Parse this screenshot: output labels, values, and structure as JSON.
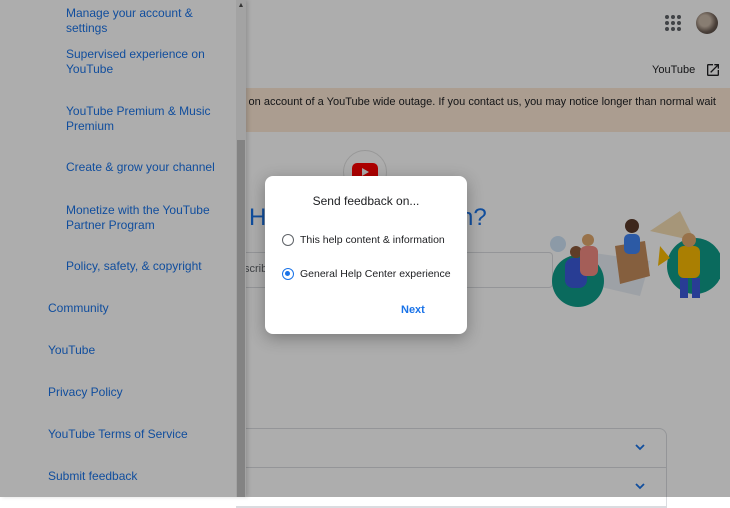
{
  "header": {
    "youtube_link_label": "YouTube"
  },
  "banner": {
    "text": "s on account of a YouTube wide outage. If you contact us, you may notice longer than normal wait"
  },
  "hero": {
    "left_fragment": "H",
    "right_fragment": "n?"
  },
  "search": {
    "placeholder_fragment": "scrib"
  },
  "sidebar": {
    "sub_items": [
      {
        "label": "Manage your account & settings"
      },
      {
        "label": "Supervised experience on YouTube"
      },
      {
        "label": "YouTube Premium & Music Premium"
      },
      {
        "label": "Create & grow your channel"
      },
      {
        "label": "Monetize with the YouTube Partner Program"
      },
      {
        "label": "Policy, safety, & copyright"
      }
    ],
    "top_items": [
      {
        "label": "Community"
      },
      {
        "label": "YouTube"
      },
      {
        "label": "Privacy Policy"
      },
      {
        "label": "YouTube Terms of Service"
      },
      {
        "label": "Submit feedback"
      }
    ]
  },
  "dialog": {
    "title": "Send feedback on...",
    "options": [
      {
        "label": "This help content & information",
        "selected": false
      },
      {
        "label": "General Help Center experience",
        "selected": true
      }
    ],
    "next_label": "Next"
  },
  "colors": {
    "accent": "#1a73e8",
    "banner": "#fce8d4",
    "youtube_red": "#ff0000"
  }
}
